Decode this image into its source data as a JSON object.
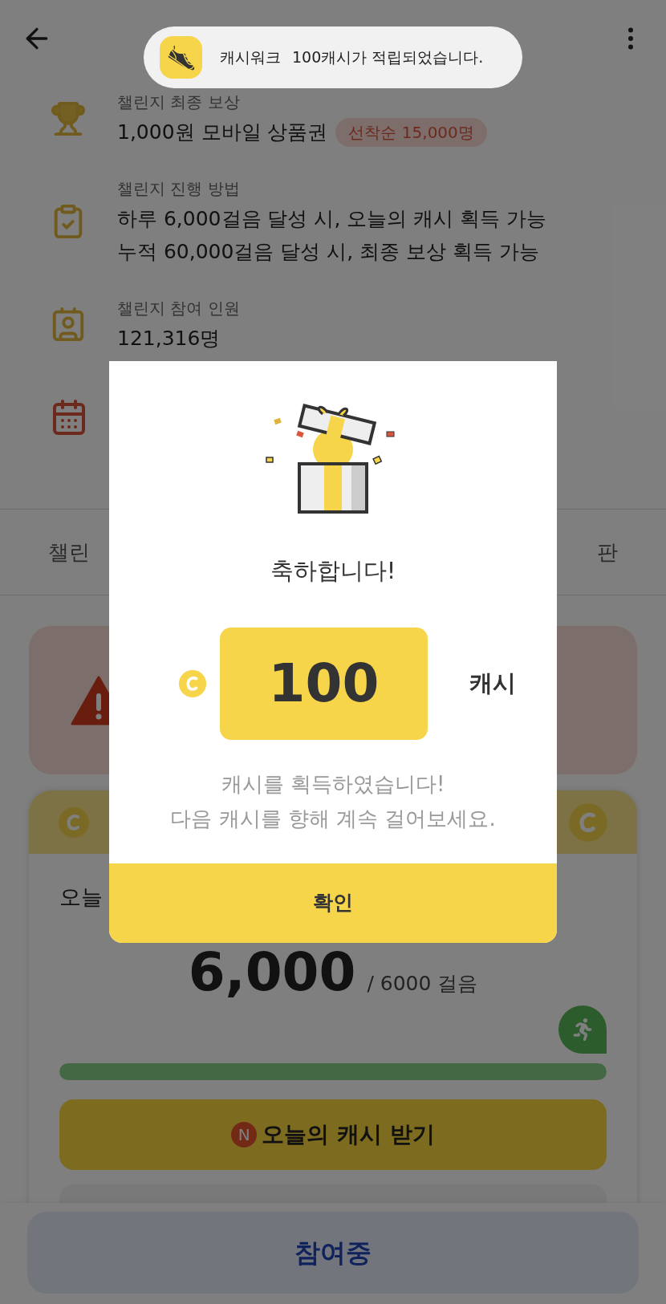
{
  "info_rows": [
    {
      "kind": "trophy",
      "label": "챌린지 최종 보상",
      "value_lines": [
        "1,000원 모바일 상품권"
      ],
      "badge": "선착순 15,000명"
    },
    {
      "kind": "clipboard",
      "label": "챌린지 진행 방법",
      "value_lines": [
        "하루 6,000걸음 달성 시, 오늘의 캐시 획득 가능",
        "누적 60,000걸음 달성 시, 최종 보상 획득 가능"
      ]
    },
    {
      "kind": "idcard",
      "label": "챌린지 참여 인원",
      "value_lines": [
        "121,316명"
      ]
    },
    {
      "kind": "calendar"
    }
  ],
  "tabs": [
    {
      "label": "챌린"
    },
    {
      "label": "판"
    }
  ],
  "today": {
    "label": "오늘",
    "steps": "6,000",
    "goal": "/ 6000 걸음",
    "level": 1.0,
    "button": {
      "badge": "N",
      "label": "오늘의 캐시 받기"
    }
  },
  "bottom_button": "참여중",
  "modal": {
    "title": "축하합니다!",
    "amount": "100",
    "unit": "캐시",
    "message_lines": [
      "캐시를 획득하였습니다!",
      "다음 캐시를 향해 계속 걸어보세요."
    ],
    "confirm": "확인"
  },
  "toast": {
    "app": "캐시워크",
    "message": "100캐시가 적립되었습니다."
  }
}
